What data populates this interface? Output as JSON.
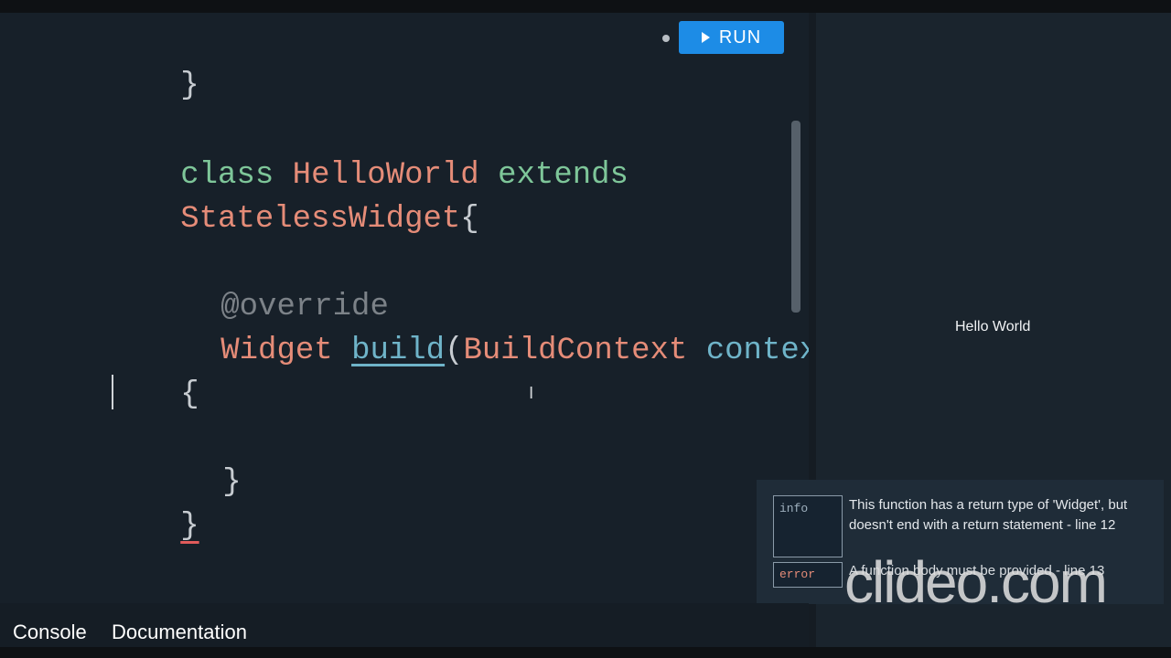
{
  "toolbar": {
    "run_label": "RUN"
  },
  "editor": {
    "top_fragment": "}",
    "line_class_kw": "class",
    "line_class_name": "HelloWorld",
    "line_extends_kw": "extends",
    "line_parent": "StatelessWidget",
    "line_parent_brace": "{",
    "annotation": "@override",
    "return_type": "Widget",
    "method_name": "build",
    "open_paren": "(",
    "param_type": "BuildContext",
    "param_name": "context",
    "close_paren": ")",
    "method_open_brace": "{",
    "method_close_brace": "}",
    "class_close_brace": "}"
  },
  "output": {
    "hello_text": "Hello World"
  },
  "issues": [
    {
      "kind": "info",
      "message": "This function has a return type of 'Widget', but doesn't end with a return statement - line 12"
    },
    {
      "kind": "error",
      "message": "A function body must be provided - line 13"
    }
  ],
  "tabs": {
    "console": "Console",
    "documentation": "Documentation"
  },
  "watermark": "clideo.com",
  "colors": {
    "run_button": "#1d8ce6",
    "keyword": "#7ec699",
    "type": "#e58c78",
    "identifier": "#6fb4c9"
  }
}
